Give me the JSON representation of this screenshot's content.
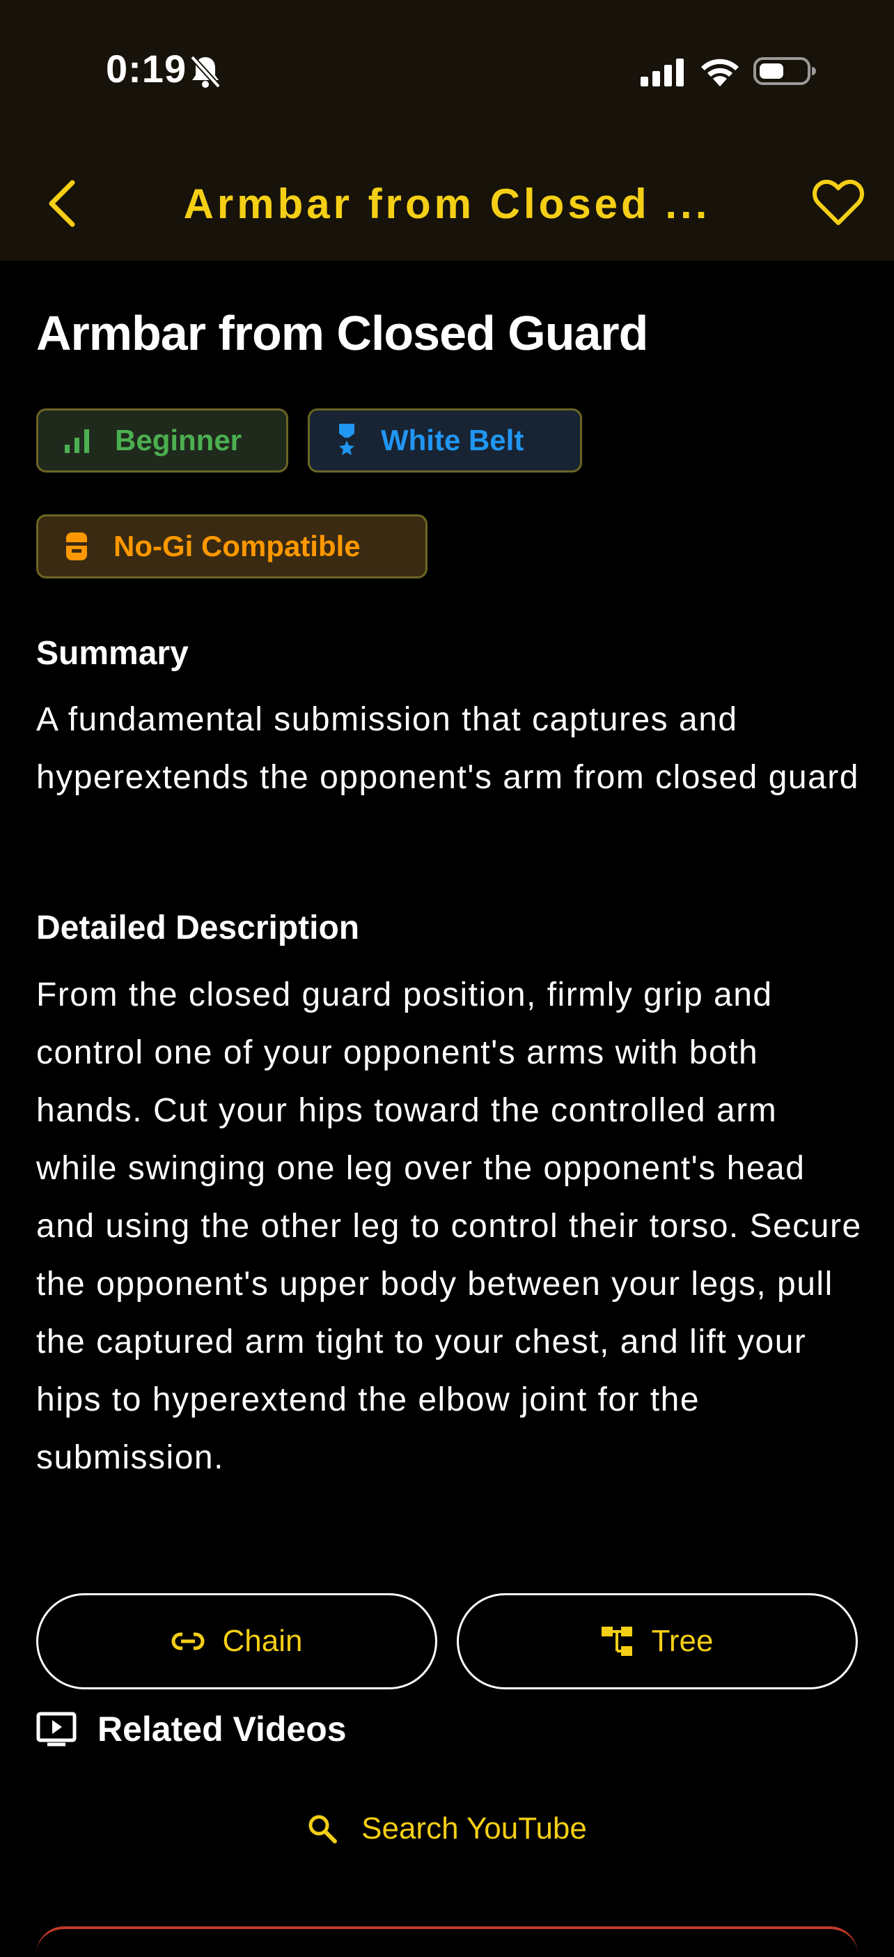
{
  "status_bar": {
    "time": "0:19"
  },
  "nav": {
    "title": "Armbar from Closed ..."
  },
  "technique": {
    "title": "Armbar from Closed Guard",
    "badges": [
      {
        "label": "Beginner",
        "icon": "signal-bars-icon",
        "color": "#4caf50"
      },
      {
        "label": "White Belt",
        "icon": "belt-medal-icon",
        "color": "#2196f3"
      },
      {
        "label": "No-Gi Compatible",
        "icon": "rash-guard-icon",
        "color": "#ff9800"
      }
    ],
    "summary_heading": "Summary",
    "summary": "A fundamental submission that captures and hyperextends the opponent's arm from closed guard",
    "description_heading": "Detailed Description",
    "description": "From the closed guard position, firmly grip and control one of your opponent's arms with both hands. Cut your hips toward the controlled arm while swinging one leg over the opponent's head and using the other leg to control their torso. Secure the opponent's upper body between your legs, pull the captured arm tight to your chest, and lift your hips to hyperextend the elbow joint for the submission."
  },
  "actions": {
    "chain_label": "Chain",
    "tree_label": "Tree"
  },
  "related": {
    "heading": "Related Videos",
    "search_label": "Search YouTube"
  },
  "colors": {
    "accent": "#f5cf16",
    "header_bg": "#17130a",
    "background": "#000000"
  }
}
